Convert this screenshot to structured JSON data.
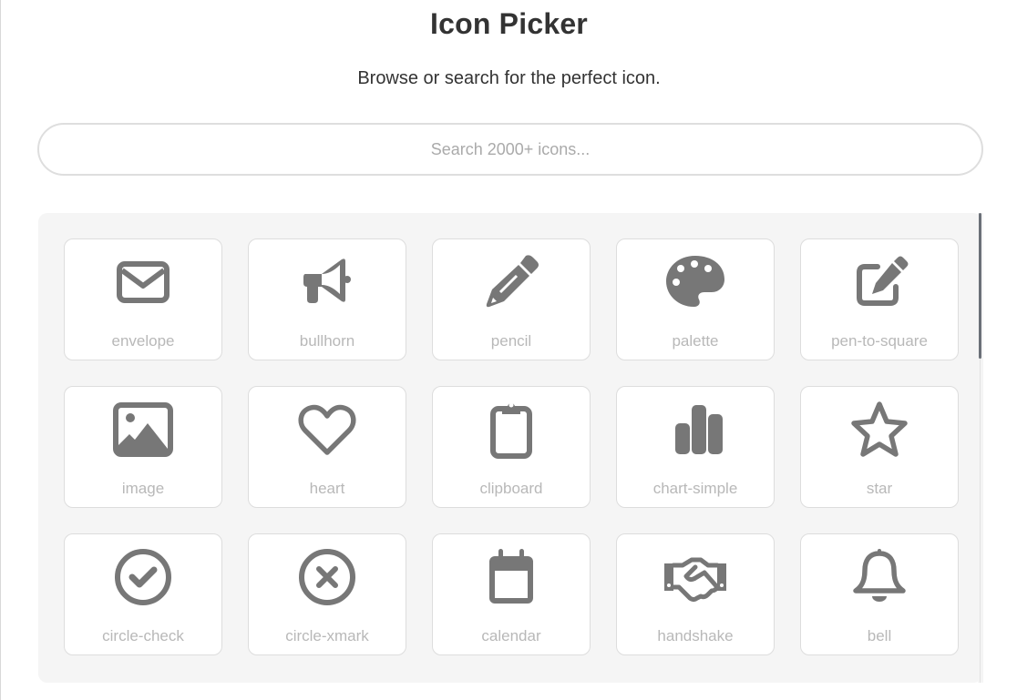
{
  "header": {
    "title": "Icon Picker",
    "subtitle": "Browse or search for the perfect icon."
  },
  "search": {
    "value": "",
    "placeholder": "Search 2000+ icons..."
  },
  "colors": {
    "icon": "#777777",
    "label": "#b8b8b8",
    "panel_bg": "#f5f5f5",
    "card_border": "#dddddd",
    "scroll_thumb": "#6b7078"
  },
  "icons": [
    {
      "name": "envelope",
      "icon": "envelope-icon"
    },
    {
      "name": "bullhorn",
      "icon": "bullhorn-icon"
    },
    {
      "name": "pencil",
      "icon": "pencil-icon"
    },
    {
      "name": "palette",
      "icon": "palette-icon"
    },
    {
      "name": "pen-to-square",
      "icon": "pen-to-square-icon"
    },
    {
      "name": "image",
      "icon": "image-icon"
    },
    {
      "name": "heart",
      "icon": "heart-icon"
    },
    {
      "name": "clipboard",
      "icon": "clipboard-icon"
    },
    {
      "name": "chart-simple",
      "icon": "chart-simple-icon"
    },
    {
      "name": "star",
      "icon": "star-icon"
    },
    {
      "name": "circle-check",
      "icon": "circle-check-icon"
    },
    {
      "name": "circle-xmark",
      "icon": "circle-xmark-icon"
    },
    {
      "name": "calendar",
      "icon": "calendar-icon"
    },
    {
      "name": "handshake",
      "icon": "handshake-icon"
    },
    {
      "name": "bell",
      "icon": "bell-icon"
    }
  ]
}
